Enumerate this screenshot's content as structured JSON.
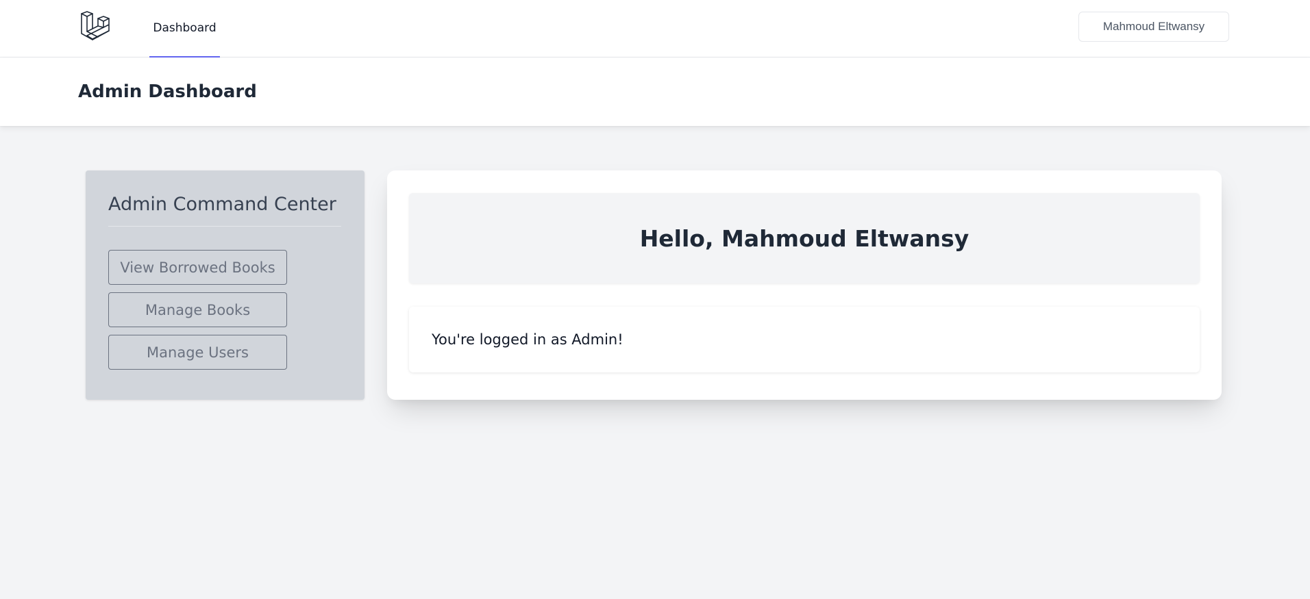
{
  "nav": {
    "logo_icon": "laravel-logo-icon",
    "links": [
      {
        "label": "Dashboard",
        "active": true
      }
    ],
    "user_name": "Mahmoud Eltwansy"
  },
  "header": {
    "title": "Admin Dashboard"
  },
  "sidebar": {
    "title": "Admin Command Center",
    "buttons": [
      {
        "label": "View Borrowed Books"
      },
      {
        "label": "Manage Books"
      },
      {
        "label": "Manage Users"
      }
    ]
  },
  "main": {
    "greeting": "Hello, Mahmoud Eltwansy",
    "status": "You're logged in as Admin!"
  },
  "colors": {
    "active_tab_underline": "#6366f1",
    "page_background": "#f3f4f6",
    "sidebar_background": "#d1d5db"
  }
}
